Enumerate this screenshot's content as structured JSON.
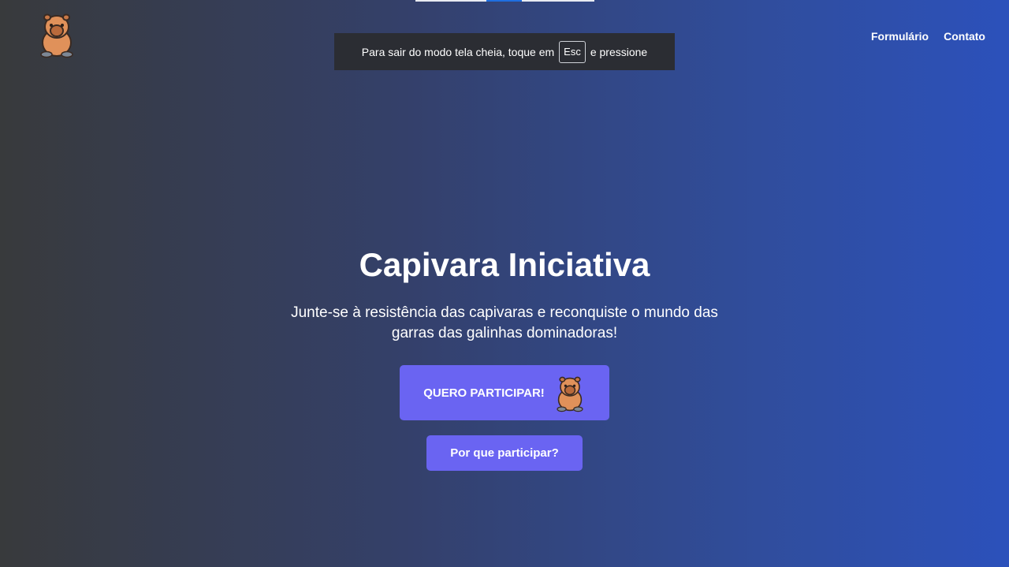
{
  "header": {
    "logo_icon": "capybara-icon",
    "nav": [
      {
        "label": "Formulário"
      },
      {
        "label": "Contato"
      }
    ]
  },
  "fullscreen_notice": {
    "before": "Para sair do modo tela cheia, toque em",
    "key": "Esc",
    "after": "e pressione"
  },
  "hero": {
    "title": "Capivara Iniciativa",
    "subtitle": "Junte-se à resistência das capivaras e reconquiste o mundo das garras das galinhas dominadoras!",
    "primary_button": {
      "label": "QUERO PARTICIPAR!",
      "icon": "capybara-icon"
    },
    "secondary_button": {
      "label": "Por que participar?"
    }
  },
  "colors": {
    "button": "#6a64f2",
    "background_start": "#383a3c",
    "background_end": "#2c51bb",
    "toast": "#2b2d33"
  }
}
